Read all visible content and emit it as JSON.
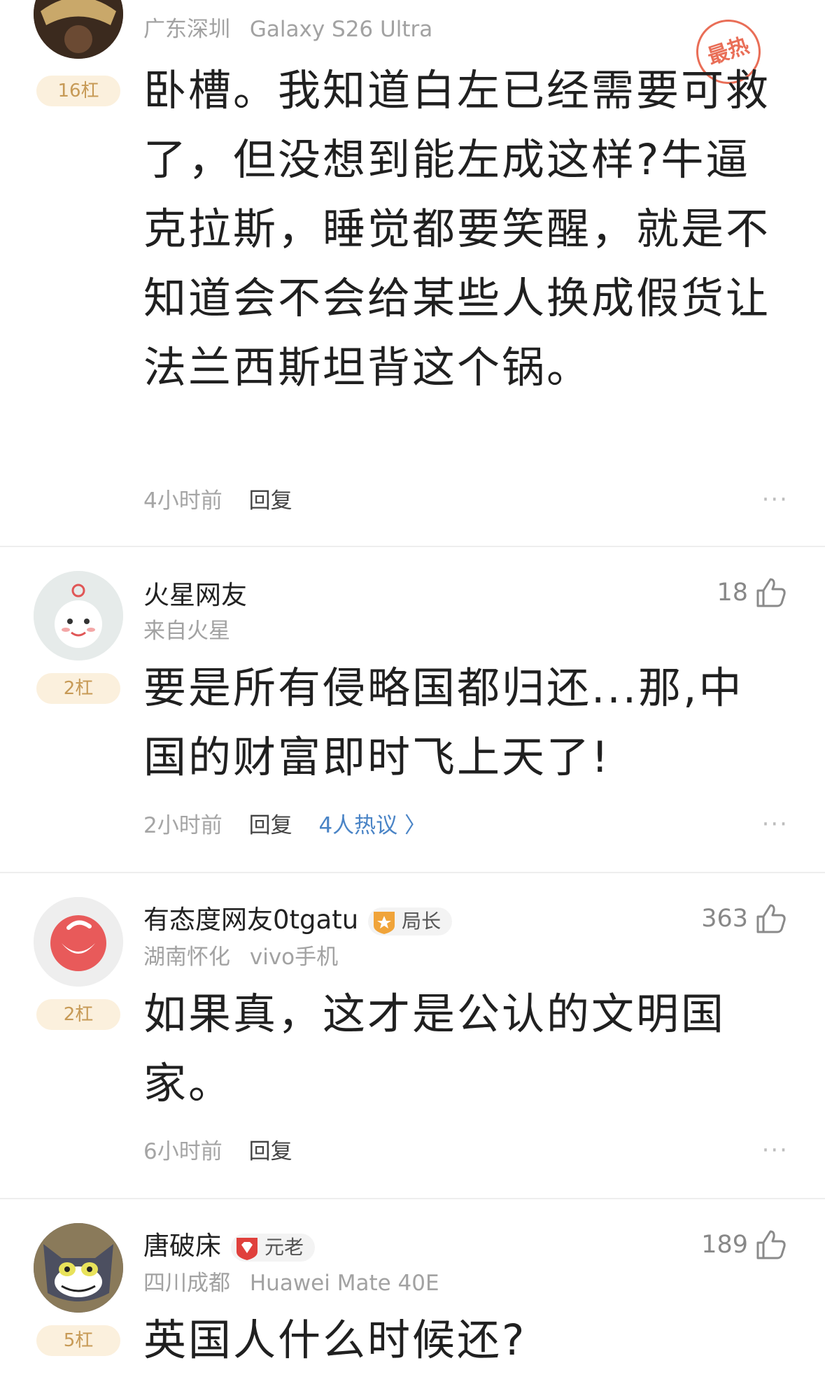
{
  "comments": [
    {
      "meta_location": "广东深圳",
      "meta_device": "Galaxy S26 Ultra",
      "gang": "16杠",
      "hot_label": "最热",
      "text": "卧槽。我知道白左已经需要可救了，但没想到能左成这样?牛逼克拉斯，睡觉都要笑醒，就是不知道会不会给某些人换成假货让法兰西斯坦背这个锅。",
      "time": "4小时前",
      "reply": "回复",
      "more": "···"
    },
    {
      "name": "火星网友",
      "meta_location": "来自火星",
      "likes": "18",
      "gang": "2杠",
      "text": "要是所有侵略国都归还...那,中国的财富即时飞上天了!",
      "time": "2小时前",
      "reply": "回复",
      "hot_discuss": "4人热议 〉",
      "more": "···"
    },
    {
      "name": "有态度网友0tgatu",
      "badge": "局长",
      "meta_location": "湖南怀化",
      "meta_device": "vivo手机",
      "likes": "363",
      "gang": "2杠",
      "text": "如果真，这才是公认的文明国家。",
      "time": "6小时前",
      "reply": "回复",
      "more": "···"
    },
    {
      "name": "唐破床",
      "badge": "元老",
      "meta_location": "四川成都",
      "meta_device": "Huawei Mate 40E",
      "likes": "189",
      "gang": "5杠",
      "text": "英国人什么时候还?"
    }
  ],
  "colors": {
    "accent_blue": "#4a84c6",
    "gang_bg": "#fbf0dd",
    "gang_text": "#c79a56",
    "hot_red": "#e6553a"
  }
}
